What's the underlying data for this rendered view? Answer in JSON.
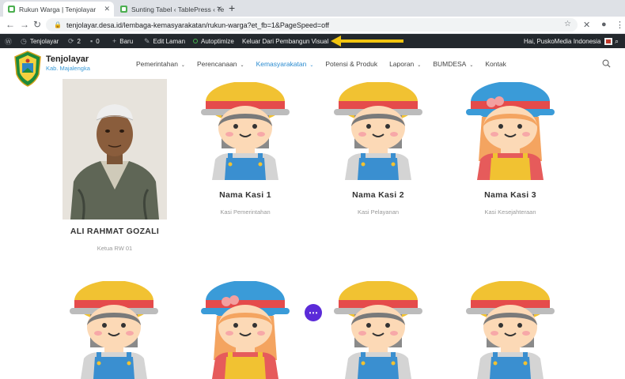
{
  "browser": {
    "tabs": [
      {
        "title": "Rukun Warga | Tenjolayar"
      },
      {
        "title": "Sunting Tabel ‹ TablePress ‹ Te"
      }
    ],
    "url": "tenjolayar.desa.id/lembaga-kemasyarakatan/rukun-warga?et_fb=1&PageSpeed=off"
  },
  "adminbar": {
    "site": "Tenjolayar",
    "updates": "2",
    "comments": "0",
    "new": "Baru",
    "edit": "Edit Laman",
    "autoptimize": "Autoptimize",
    "exit_builder": "Keluar Dari Pembangun Visual",
    "greeting": "Hai, PuskoMedia Indonesia"
  },
  "site": {
    "title": "Tenjolayar",
    "subtitle": "Kab. Majalengka"
  },
  "menu": [
    {
      "label": "Pemerintahan",
      "dropdown": true
    },
    {
      "label": "Perencanaan",
      "dropdown": true
    },
    {
      "label": "Kemasyarakatan",
      "dropdown": true,
      "active": true
    },
    {
      "label": "Potensi & Produk",
      "dropdown": false
    },
    {
      "label": "Laporan",
      "dropdown": true
    },
    {
      "label": "BUMDESA",
      "dropdown": true
    },
    {
      "label": "Kontak",
      "dropdown": false
    }
  ],
  "members": [
    {
      "name": "ALI RAHMAT GOZALI",
      "role": "Ketua RW 01",
      "avatar": "photo"
    },
    {
      "name": "Nama Kasi 1",
      "role": "Kasi Pemerintahan",
      "avatar": "boy-hat"
    },
    {
      "name": "Nama Kasi 2",
      "role": "Kasi Pelayanan",
      "avatar": "boy-hat"
    },
    {
      "name": "Nama Kasi 3",
      "role": "Kasi Kesejahteraan",
      "avatar": "girl-hat"
    }
  ],
  "colors": {
    "accent": "#2a8bd0",
    "admin_bar": "#23282d",
    "highlight_arrow": "#f1c40f",
    "builder_fab": "#5b2bd8"
  }
}
